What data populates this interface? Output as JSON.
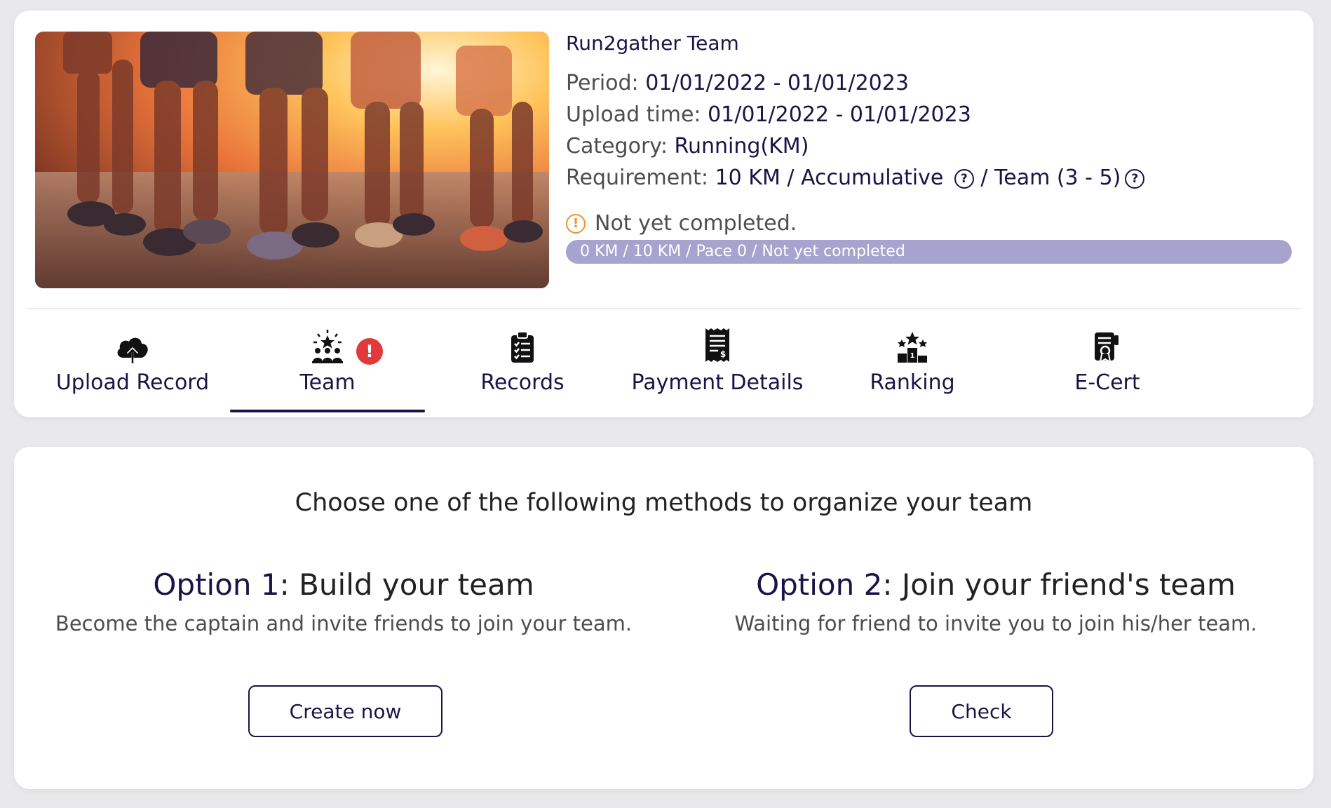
{
  "event": {
    "title": "Run2gather Team",
    "period_label": "Period: ",
    "period_value": "01/01/2022 - 01/01/2023",
    "upload_label": "Upload time: ",
    "upload_value": "01/01/2022 - 01/01/2023",
    "category_label": "Category: ",
    "category_value": "Running(KM)",
    "requirement_label": "Requirement: ",
    "requirement_value_1": "10 KM / Accumulative",
    "requirement_value_2": " / Team (3 - 5)",
    "help_icon": "question-circle-icon",
    "status_icon": "warning-circle-icon",
    "status_text": "Not yet completed.",
    "progress_text": "0 KM / 10 KM / Pace 0 / Not yet completed",
    "progress_fraction": 0
  },
  "tabs": [
    {
      "label": "Upload Record",
      "icon": "cloud-upload-icon"
    },
    {
      "label": "Team",
      "icon": "team-star-icon",
      "badge": "!",
      "active": true
    },
    {
      "label": "Records",
      "icon": "clipboard-checklist-icon"
    },
    {
      "label": "Payment Details",
      "icon": "receipt-icon"
    },
    {
      "label": "Ranking",
      "icon": "podium-icon"
    },
    {
      "label": "E-Cert",
      "icon": "certificate-icon"
    }
  ],
  "team": {
    "heading": "Choose one of the following methods to organize your team",
    "option1": {
      "num": "Option 1",
      "title": ": Build your team",
      "desc": "Become the captain and invite friends to join your team.",
      "button": "Create now"
    },
    "option2": {
      "num": "Option 2",
      "title": ": Join your friend's team",
      "desc": "Waiting for friend to invite you to join his/her team.",
      "button": "Check"
    }
  },
  "colors": {
    "brand": "#1a1446",
    "progress_track": "#a7a3cf",
    "warning": "#f0922b",
    "badge": "#e23a3a"
  }
}
